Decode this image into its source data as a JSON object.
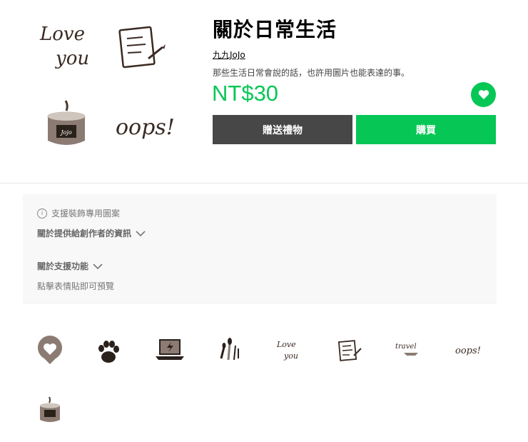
{
  "product": {
    "title": "關於日常生活",
    "author": "九九JoJo",
    "description": "那些生活日常會說的話，也許用圖片也能表達的事。",
    "price": "NT$30",
    "gift_label": "贈送禮物",
    "buy_label": "購買"
  },
  "hero_texts": {
    "love": "Love",
    "you": "you",
    "oops": "oops!"
  },
  "info": {
    "support_note": "支援裝飾專用圖案",
    "creator_info_label": "關於提供給創作者的資訊",
    "support_feature_label": "關於支援功能",
    "preview_hint": "點擊表情貼即可預覽"
  },
  "stickers": [
    {
      "name": "heart-bubble"
    },
    {
      "name": "paw-print"
    },
    {
      "name": "laptop"
    },
    {
      "name": "makeup-brushes"
    },
    {
      "name": "love-you",
      "text1": "Love",
      "text2": "you"
    },
    {
      "name": "notepad"
    },
    {
      "name": "travel",
      "text": "travel"
    },
    {
      "name": "oops",
      "text": "oops!"
    },
    {
      "name": "candle"
    }
  ],
  "colors": {
    "accent": "#06c755",
    "gift_button": "#474747",
    "sticker_brown": "#8b7b73",
    "ink": "#3a2a22"
  }
}
